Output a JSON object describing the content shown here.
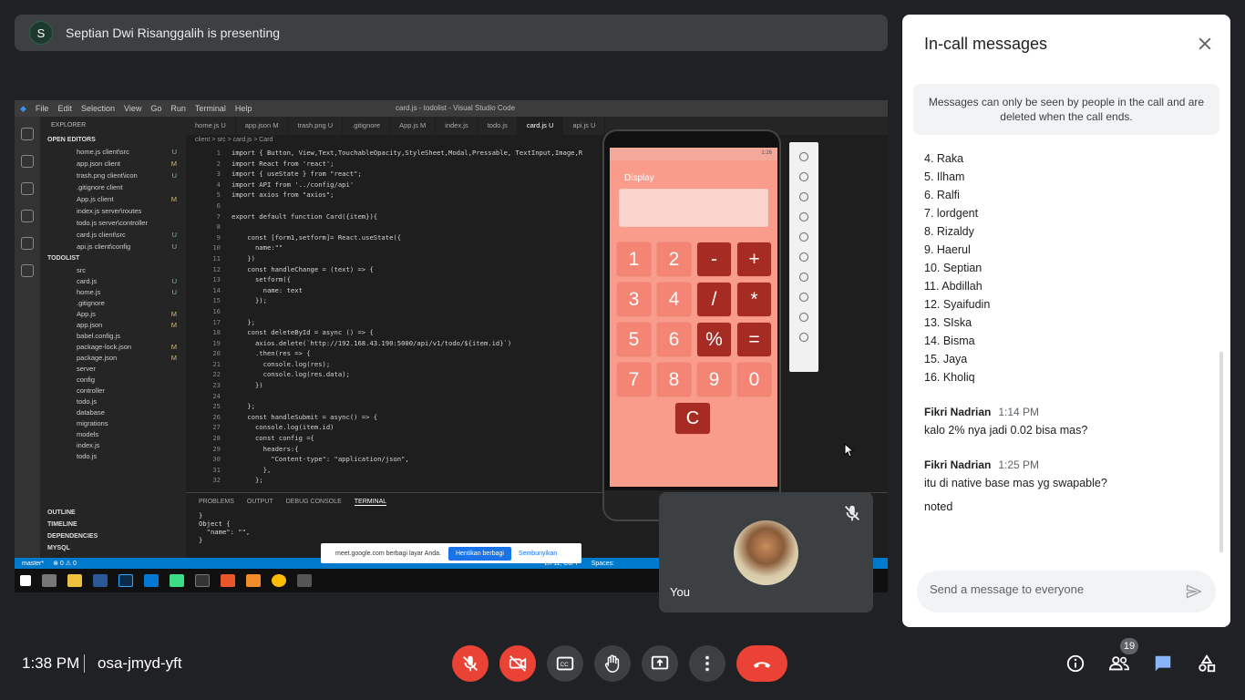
{
  "presenter": {
    "avatar_letter": "S",
    "text": "Septian Dwi Risanggalih is presenting"
  },
  "shared_screen": {
    "menu": [
      "File",
      "Edit",
      "Selection",
      "View",
      "Go",
      "Run",
      "Terminal",
      "Help"
    ],
    "window_title": "card.js - todolist - Visual Studio Code",
    "explorer_header": "EXPLORER",
    "open_editors_title": "OPEN EDITORS",
    "open_editors": [
      {
        "name": "home.js client\\src",
        "git": "U"
      },
      {
        "name": "app.json client",
        "git": "M"
      },
      {
        "name": "trash.png client\\icon",
        "git": "U"
      },
      {
        "name": ".gitignore client",
        "git": ""
      },
      {
        "name": "App.js client",
        "git": "M"
      },
      {
        "name": "index.js server\\routes",
        "git": ""
      },
      {
        "name": "todo.js server\\controller",
        "git": ""
      },
      {
        "name": "card.js client\\src",
        "git": "U"
      },
      {
        "name": "api.js client\\config",
        "git": "U"
      }
    ],
    "project_title": "TODOLIST",
    "project_files": [
      {
        "name": "src",
        "git": ""
      },
      {
        "name": "card.js",
        "git": "U"
      },
      {
        "name": "home.js",
        "git": "U"
      },
      {
        "name": ".gitignore",
        "git": ""
      },
      {
        "name": "App.js",
        "git": "M"
      },
      {
        "name": "app.json",
        "git": "M"
      },
      {
        "name": "babel.config.js",
        "git": ""
      },
      {
        "name": "package-lock.json",
        "git": "M"
      },
      {
        "name": "package.json",
        "git": "M"
      },
      {
        "name": "server",
        "git": ""
      },
      {
        "name": "config",
        "git": ""
      },
      {
        "name": "controller",
        "git": ""
      },
      {
        "name": "todo.js",
        "git": ""
      },
      {
        "name": "database",
        "git": ""
      },
      {
        "name": "migrations",
        "git": ""
      },
      {
        "name": "models",
        "git": ""
      },
      {
        "name": "index.js",
        "git": ""
      },
      {
        "name": "todo.js",
        "git": ""
      }
    ],
    "bottom_sections": [
      "OUTLINE",
      "TIMELINE",
      "DEPENDENCIES",
      "MYSQL"
    ],
    "tabs": [
      "home.js U",
      "app.json M",
      "trash.png U",
      ".gitignore",
      "App.js M",
      "index.js",
      "todo.js",
      "card.js U",
      "api.js U"
    ],
    "breadcrumb": "client > src > card.js > Card",
    "code": [
      "import { Button, View,Text,TouchableOpacity,StyleSheet,Modal,Pressable, TextInput,Image,R",
      "import React from 'react';",
      "import { useState } from \"react\";",
      "import API from '../config/api'",
      "import axios from \"axios\";",
      "",
      "export default function Card({item}){",
      "",
      "    const [form1,setform]= React.useState({",
      "      name:\"\"",
      "    })",
      "    const handleChange = (text) => {",
      "      setform({",
      "        name: text",
      "      });",
      "",
      "    };",
      "    const deleteById = async () => {",
      "      axios.delete(`http://192.168.43.190:5000/api/v1/todo/${item.id}`)",
      "      .then(res => {",
      "        console.log(res);",
      "        console.log(res.data);",
      "      })",
      "",
      "    };",
      "    const handleSubmit = async() => {",
      "      console.log(item.id)",
      "      const config ={",
      "        headers:{",
      "          \"Content-type\": \"application/json\",",
      "        },",
      "      };"
    ],
    "panel_tabs": [
      "PROBLEMS",
      "OUTPUT",
      "DEBUG CONSOLE",
      "TERMINAL"
    ],
    "terminal_text": "}\nObject {\n  \"name\": \"\",\n}",
    "status_left": [
      "master*",
      "⊗ 0 ⚠ 0"
    ],
    "status_right": [
      "Ln 11, Col 7",
      "Spaces:"
    ],
    "share_notice": {
      "text": "meet.google.com berbagi layar Anda.",
      "stop": "Hentikan berbagi",
      "hide": "Sembunyikan"
    },
    "calculator": {
      "status_time": "1:26",
      "display_label": "Display",
      "rows": [
        [
          "1",
          "2",
          "-",
          "+"
        ],
        [
          "3",
          "4",
          "/",
          "*"
        ],
        [
          "5",
          "6",
          "%",
          "="
        ],
        [
          "7",
          "8",
          "9",
          "0"
        ]
      ],
      "clear": "C"
    }
  },
  "self_tile": {
    "name": "You"
  },
  "panel": {
    "title": "In-call messages",
    "info": "Messages can only be seen by people in the call and are deleted when the call ends.",
    "list": [
      "4. Raka",
      "5. Ilham",
      "6. Ralfi",
      "7. lordgent",
      "8. Rizaldy",
      "9. Haerul",
      "10. Septian",
      "11. Abdillah",
      "12. Syaifudin",
      "13. SIska",
      "14. Bisma",
      "15. Jaya",
      "16. Kholiq"
    ],
    "messages": [
      {
        "sender": "Fikri Nadrian",
        "time": "1:14 PM",
        "lines": [
          "kalo 2% nya jadi 0.02 bisa mas?"
        ]
      },
      {
        "sender": "Fikri Nadrian",
        "time": "1:25 PM",
        "lines": [
          "itu di native base mas yg swapable?",
          "noted"
        ]
      }
    ],
    "input_placeholder": "Send a message to everyone"
  },
  "bottom_bar": {
    "time": "1:38 PM",
    "meeting_code": "osa-jmyd-yft",
    "participants_count": "19"
  },
  "colors": {
    "end_call": "#ea4335",
    "chat_active": "#8ab4f8",
    "bg": "#202124"
  }
}
